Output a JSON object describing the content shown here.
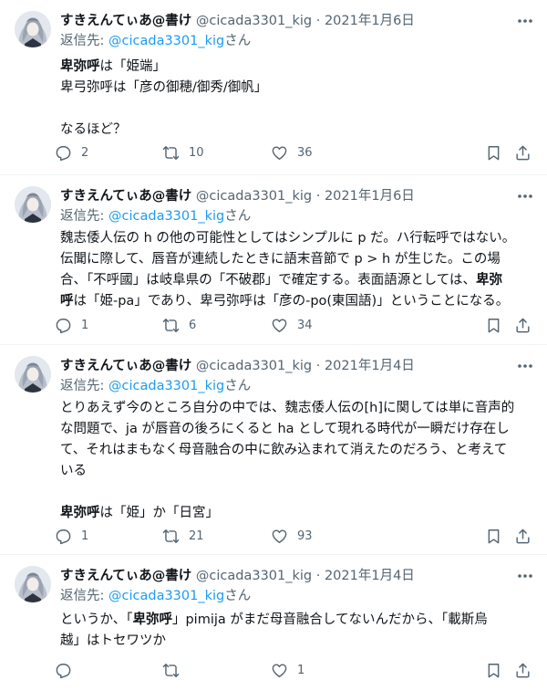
{
  "tweets": [
    {
      "name": "すきえんてぃあ@書け",
      "handle": "@cicada3301_kig",
      "date": "2021年1月6日",
      "reply_prefix": "返信先: ",
      "reply_handle": "@cicada3301_kig",
      "reply_suffix": "さん",
      "body": [
        [
          {
            "b": "卑弥呼"
          },
          {
            "t": "は「姫端」"
          }
        ],
        [
          {
            "t": "卑弓弥呼は「彦の御穂/御秀/御帆」"
          }
        ],
        [],
        [
          {
            "t": "なるほど？"
          }
        ]
      ],
      "stats": {
        "replies": "2",
        "retweets": "10",
        "likes": "36"
      }
    },
    {
      "name": "すきえんてぃあ@書け",
      "handle": "@cicada3301_kig",
      "date": "2021年1月6日",
      "reply_prefix": "返信先: ",
      "reply_handle": "@cicada3301_kig",
      "reply_suffix": "さん",
      "body": [
        [
          {
            "t": "魏志倭人伝の h の他の可能性としてはシンプルに p だ。ハ行転呼ではない。"
          }
        ],
        [
          {
            "t": "伝聞に際して、唇音が連続したときに語末音節で p > h が生じた。この場"
          }
        ],
        [
          {
            "t": "合、「不呼國」は岐阜県の「不破郡」で確定する。表面語源としては、"
          },
          {
            "b": "卑弥"
          }
        ],
        [
          {
            "b": "呼"
          },
          {
            "t": "は「姫-pa」であり、卑弓弥呼は「彦の-po(東国語)」ということになる。"
          }
        ]
      ],
      "stats": {
        "replies": "1",
        "retweets": "6",
        "likes": "34"
      }
    },
    {
      "name": "すきえんてぃあ@書け",
      "handle": "@cicada3301_kig",
      "date": "2021年1月4日",
      "reply_prefix": "返信先: ",
      "reply_handle": "@cicada3301_kig",
      "reply_suffix": "さん",
      "body": [
        [
          {
            "t": "とりあえず今のところ自分の中では、魏志倭人伝の[h]に関しては単に音声的"
          }
        ],
        [
          {
            "t": "な問題で、ja が唇音の後ろにくると ha として現れる時代が一瞬だけ存在し"
          }
        ],
        [
          {
            "t": "て、それはまもなく母音融合の中に飲み込まれて消えたのだろう、と考えて"
          }
        ],
        [
          {
            "t": "いる"
          }
        ],
        [],
        [
          {
            "b": "卑弥呼"
          },
          {
            "t": "は「姫」か「日宮」"
          }
        ]
      ],
      "stats": {
        "replies": "1",
        "retweets": "21",
        "likes": "93"
      }
    },
    {
      "name": "すきえんてぃあ@書け",
      "handle": "@cicada3301_kig",
      "date": "2021年1月4日",
      "reply_prefix": "返信先: ",
      "reply_handle": "@cicada3301_kig",
      "reply_suffix": "さん",
      "body": [
        [
          {
            "t": "というか、「"
          },
          {
            "b": "卑弥呼"
          },
          {
            "t": "」pimija がまだ母音融合してないんだから、「載斯烏"
          }
        ],
        [
          {
            "t": "越」はトセワツか"
          }
        ]
      ],
      "stats": {
        "replies": "",
        "retweets": "",
        "likes": "1"
      }
    }
  ],
  "colors": {
    "text": "#0f1419",
    "secondary": "#536471",
    "link": "#1d9bf0",
    "divider": "#eff3f4"
  },
  "icons": [
    "reply-icon",
    "retweet-icon",
    "like-icon",
    "bookmark-icon",
    "share-icon",
    "more-icon"
  ]
}
